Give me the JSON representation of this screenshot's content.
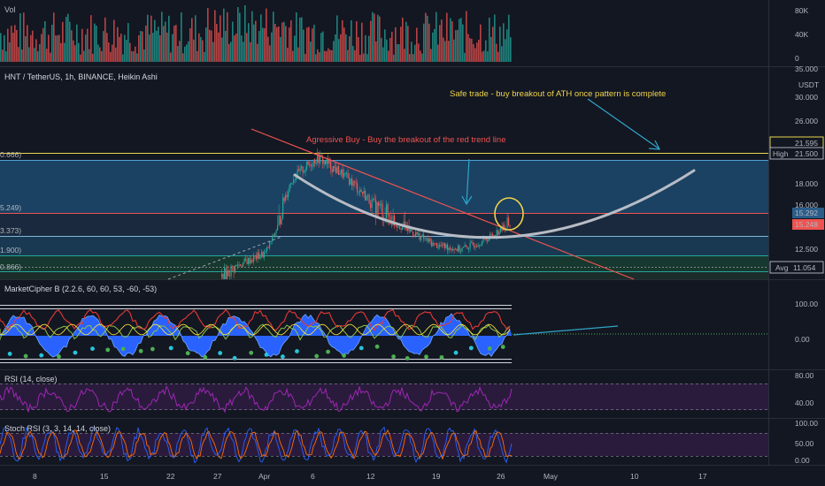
{
  "volume_pane": {
    "label": "Vol",
    "ticks": [
      "80K",
      "40K",
      "0"
    ]
  },
  "price_pane": {
    "title": "HNT / TetherUS, 1h, BINANCE, Heikin Ashi",
    "currency": "USDT",
    "ticks": [
      "35.000",
      "30.000",
      "26.000",
      "21.500",
      "18.000",
      "16.000",
      "12.500"
    ],
    "left_labels": [
      "0.666)",
      "5.249)",
      "3.373)",
      "1.900)",
      "0.866)"
    ],
    "badges": {
      "high_label": "High",
      "high_value": "21.500",
      "top_value": "21.595",
      "cyan_value": "15.292",
      "red_value": "15.248",
      "avg_label": "Avg",
      "avg_value": "11.054"
    },
    "annotations": {
      "aggressive": "Agressive Buy - Buy the breakout of the red trend line",
      "safe": "Safe trade - buy breakout of ATH once pattern is complete"
    }
  },
  "marketcipher_pane": {
    "title": "MarketCipher B (2.2.6, 60, 60, 53, -60, -53)",
    "ticks": [
      "100.00",
      "0.00"
    ]
  },
  "rsi_pane": {
    "title": "RSI (14, close)",
    "ticks": [
      "80.00",
      "40.00"
    ]
  },
  "stoch_pane": {
    "title": "Stoch RSI (3, 3, 14, 14, close)",
    "ticks": [
      "100.00",
      "50.00",
      "0.00"
    ]
  },
  "x_axis": {
    "ticks": [
      "8",
      "15",
      "22",
      "27",
      "Apr",
      "6",
      "12",
      "19",
      "26",
      "May",
      "10",
      "17"
    ]
  },
  "colors": {
    "background": "#131722",
    "bull": "#26a69a",
    "bear": "#ef5350",
    "trendline": "#ef5350",
    "curve": "#b2b5be",
    "arrow": "#2fa6c9",
    "high_line": "#e8d44d",
    "aggressive_text": "#ef5350",
    "safe_text": "#f0d44a"
  },
  "chart_data": {
    "type": "candlestick",
    "title": "HNT / TetherUS, 1h, BINANCE, Heikin Ashi",
    "xlabel": "",
    "ylabel": "USDT",
    "x_ticks": [
      "8",
      "15",
      "22",
      "27",
      "Apr",
      "6",
      "12",
      "19",
      "26",
      "May",
      "10",
      "17"
    ],
    "y_ticks": [
      35.0,
      30.0,
      26.0,
      21.5,
      18.0,
      16.0,
      12.5
    ],
    "ylim": [
      10.5,
      35.0
    ],
    "price_path": [
      {
        "x": "27",
        "y": 10.6
      },
      {
        "x": "Apr",
        "y": 12.2
      },
      {
        "x": "4",
        "y": 18.6
      },
      {
        "x": "6",
        "y": 21.0
      },
      {
        "x": "8",
        "y": 19.2
      },
      {
        "x": "12",
        "y": 16.2
      },
      {
        "x": "16",
        "y": 15.0
      },
      {
        "x": "19",
        "y": 13.0
      },
      {
        "x": "23",
        "y": 12.5
      },
      {
        "x": "25",
        "y": 13.4
      },
      {
        "x": "26",
        "y": 15.3
      }
    ],
    "levels": {
      "high": 21.5,
      "top": 21.595,
      "cyan": 15.292,
      "red": 15.248,
      "avg": 11.054
    },
    "fib_left_labels": [
      "0.666)",
      "5.249)",
      "3.373)",
      "1.900)",
      "0.866)"
    ],
    "annotations": [
      "Agressive Buy - Buy the breakout of the red trend line",
      "Safe trade - buy breakout of ATH once pattern is complete"
    ],
    "indicators": [
      {
        "name": "MarketCipher B (2.2.6, 60, 60, 53, -60, -53)",
        "ticks": [
          100,
          0
        ]
      },
      {
        "name": "RSI (14, close)",
        "ticks": [
          80,
          40
        ]
      },
      {
        "name": "Stoch RSI (3, 3, 14, 14, close)",
        "ticks": [
          100,
          50,
          0
        ]
      }
    ],
    "volume": {
      "name": "Vol",
      "ticks": [
        "80K",
        "40K",
        "0"
      ]
    }
  }
}
